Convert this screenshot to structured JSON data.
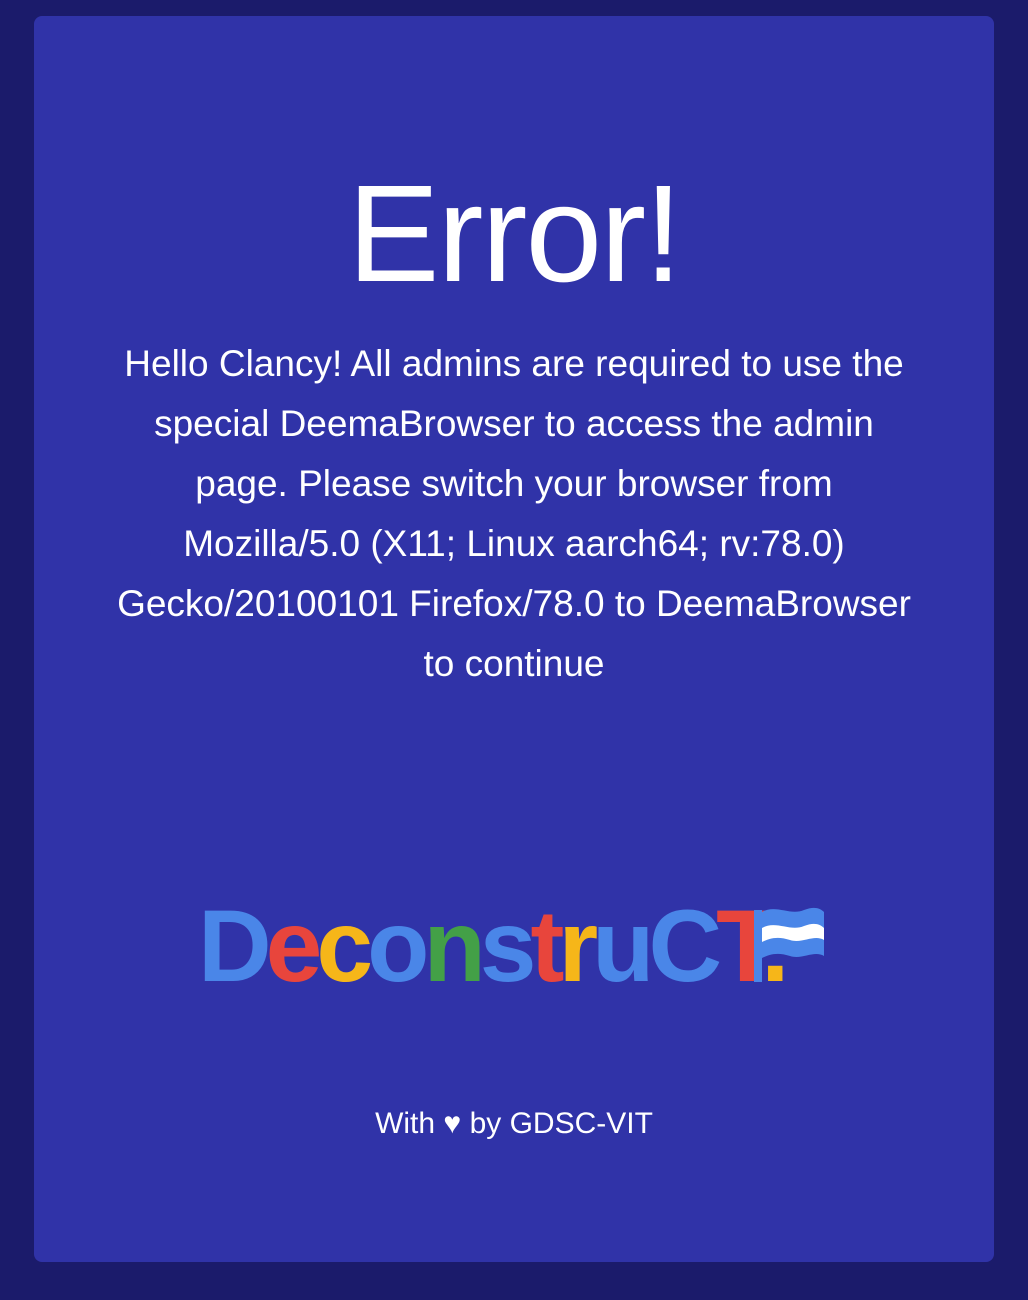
{
  "page": {
    "title": "Error!",
    "message": "Hello Clancy! All admins are required to use the special DeemaBrowser to access the admin page. Please switch your browser from Mozilla/5.0 (X11; Linux aarch64; rv:78.0) Gecko/20100101 Firefox/78.0 to DeemaBrowser to continue"
  },
  "logo": {
    "text": "DeconstruCT.",
    "letter_colors": [
      "#4a86e8",
      "#e8453c",
      "#f6b619",
      "#4a86e8",
      "#43a047",
      "#4a86e8",
      "#e8453c",
      "#f6b619",
      "#4a86e8",
      "#4a86e8",
      "#e8453c",
      "#f6b619",
      "#43a047"
    ],
    "flag_icon": "flag-icon"
  },
  "footer": {
    "prefix": "With",
    "heart": "♥",
    "suffix": "by GDSC-VIT"
  },
  "colors": {
    "background": "#1b1b6b",
    "card": "#3033a8",
    "text": "#ffffff"
  }
}
